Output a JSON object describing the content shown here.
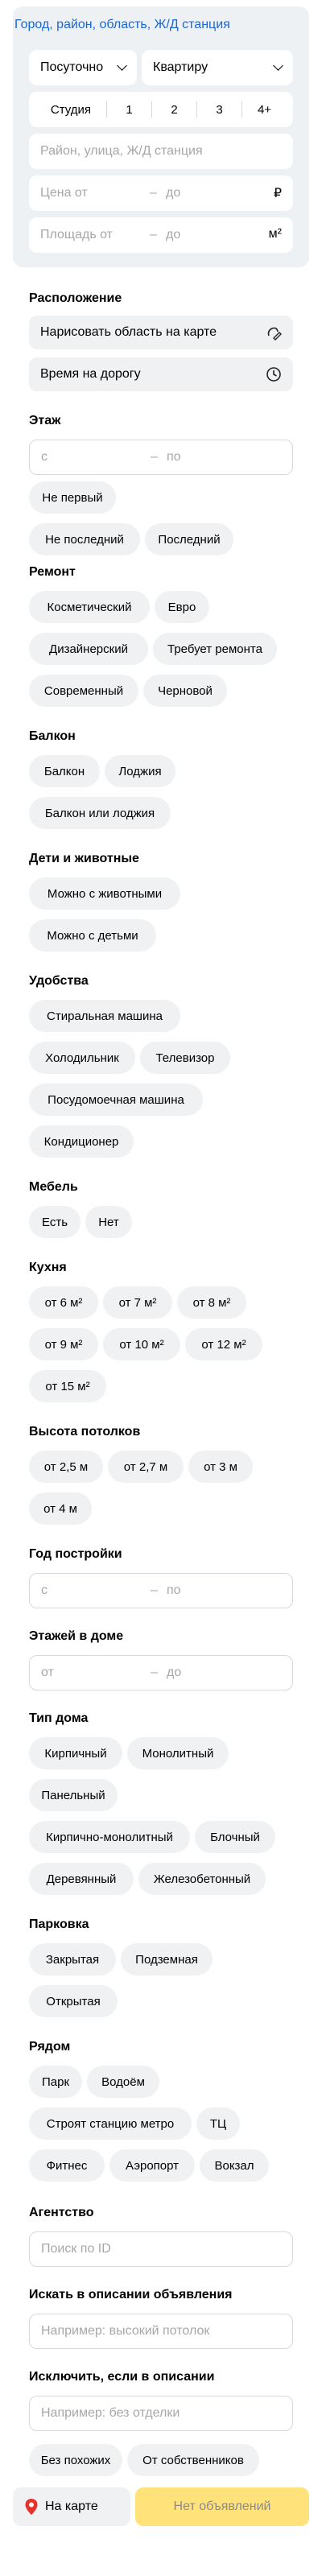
{
  "top": {
    "geo_link": "Город, район, область, Ж/Д станция",
    "deal_type": "Посуточно",
    "object_type": "Квартиру",
    "rooms": [
      "Студия",
      "1",
      "2",
      "3",
      "4+"
    ],
    "address_placeholder": "Район, улица, Ж/Д станция",
    "price_from": "Цена от",
    "price_dash": "–",
    "price_to": "до",
    "price_unit": "₽",
    "area_from": "Площадь от",
    "area_dash": "–",
    "area_to": "до",
    "area_unit": "м²"
  },
  "location": {
    "title": "Расположение",
    "draw_area": "Нарисовать область на карте",
    "travel_time": "Время на дорогу"
  },
  "floor": {
    "title": "Этаж",
    "from": "с",
    "dash": "–",
    "to": "по",
    "chips": [
      "Не первый",
      "Не последний",
      "Последний"
    ]
  },
  "renovation": {
    "title": "Ремонт",
    "chips": [
      "Косметический",
      "Евро",
      "Дизайнерский",
      "Требует ремонта",
      "Современный",
      "Черновой"
    ]
  },
  "balcony": {
    "title": "Балкон",
    "chips": [
      "Балкон",
      "Лоджия",
      "Балкон или лоджия"
    ]
  },
  "kids_pets": {
    "title": "Дети и животные",
    "chips": [
      "Можно с животными",
      "Можно с детьми"
    ]
  },
  "amenities": {
    "title": "Удобства",
    "chips": [
      "Стиральная машина",
      "Холодильник",
      "Телевизор",
      "Посудомоечная машина",
      "Кондиционер"
    ]
  },
  "furniture": {
    "title": "Мебель",
    "chips": [
      "Есть",
      "Нет"
    ]
  },
  "kitchen": {
    "title": "Кухня",
    "chips": [
      "от 6 м²",
      "от 7 м²",
      "от 8 м²",
      "от 9 м²",
      "от 10 м²",
      "от 12 м²",
      "от 15 м²"
    ]
  },
  "ceiling": {
    "title": "Высота потолков",
    "chips": [
      "от 2,5 м",
      "от 2,7 м",
      "от 3 м",
      "от 4 м"
    ]
  },
  "year": {
    "title": "Год постройки",
    "from": "с",
    "dash": "–",
    "to": "по"
  },
  "floors_total": {
    "title": "Этажей в доме",
    "from": "от",
    "dash": "–",
    "to": "до"
  },
  "house_type": {
    "title": "Тип дома",
    "chips": [
      "Кирпичный",
      "Монолитный",
      "Панельный",
      "Кирпично-монолитный",
      "Блочный",
      "Деревянный",
      "Железобетонный"
    ]
  },
  "parking": {
    "title": "Парковка",
    "chips": [
      "Закрытая",
      "Подземная",
      "Открытая"
    ]
  },
  "nearby": {
    "title": "Рядом",
    "chips": [
      "Парк",
      "Водоём",
      "Строят станцию метро",
      "ТЦ",
      "Фитнес",
      "Аэропорт",
      "Вокзал"
    ]
  },
  "agency": {
    "title": "Агентство",
    "placeholder": "Поиск по ID"
  },
  "search_desc": {
    "title": "Искать в описании объявления",
    "placeholder": "Например: высокий потолок"
  },
  "exclude_desc": {
    "title": "Исключить, если в описании",
    "placeholder": "Например: без отделки"
  },
  "extra": {
    "chips": [
      "Без похожих",
      "От собственников"
    ]
  },
  "bottom_bar": {
    "map_label": "На карте",
    "show_label": "Нет объявлений"
  },
  "colors": {
    "accent": "#1a66d6",
    "chip_bg": "#eff1f3",
    "cta": "#ffe37a",
    "map_pin": "#e5322d"
  }
}
